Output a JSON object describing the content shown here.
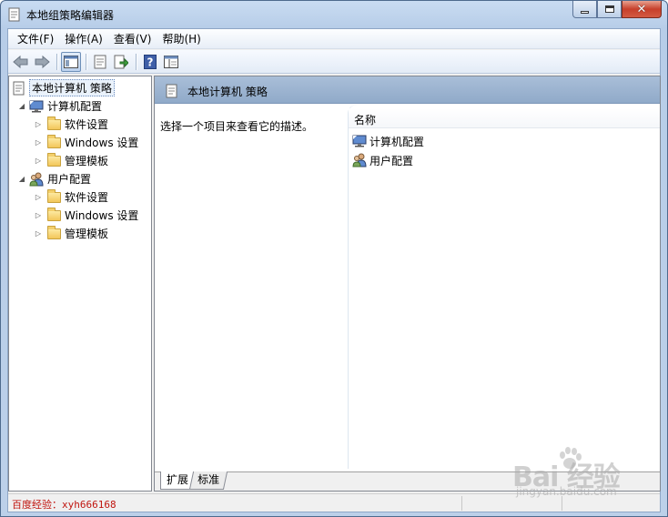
{
  "window": {
    "title": "本地组策略编辑器"
  },
  "menu": [
    "文件(F)",
    "操作(A)",
    "查看(V)",
    "帮助(H)"
  ],
  "toolbar": {
    "buttons": [
      "back-icon",
      "forward-icon",
      "show-hide-tree-icon",
      "properties-icon",
      "export-list-icon",
      "help-icon",
      "extended-view-icon"
    ]
  },
  "tree": {
    "root": "本地计算机 策略",
    "computer_config": "计算机配置",
    "computer_children": [
      "软件设置",
      "Windows 设置",
      "管理模板"
    ],
    "user_config": "用户配置",
    "user_children": [
      "软件设置",
      "Windows 设置",
      "管理模板"
    ]
  },
  "content": {
    "header_title": "本地计算机 策略",
    "description": "选择一个项目来查看它的描述。",
    "column_name": "名称",
    "items": [
      "计算机配置",
      "用户配置"
    ]
  },
  "tabs": [
    "扩展",
    "标准"
  ],
  "status": {
    "text": "百度经验：xyh666168"
  },
  "watermark": {
    "main": "Bai 经验",
    "sub": "jingyan.baidu.com"
  },
  "colors": {
    "status_text": "#c0140e",
    "header_band": "#a9bed8"
  }
}
